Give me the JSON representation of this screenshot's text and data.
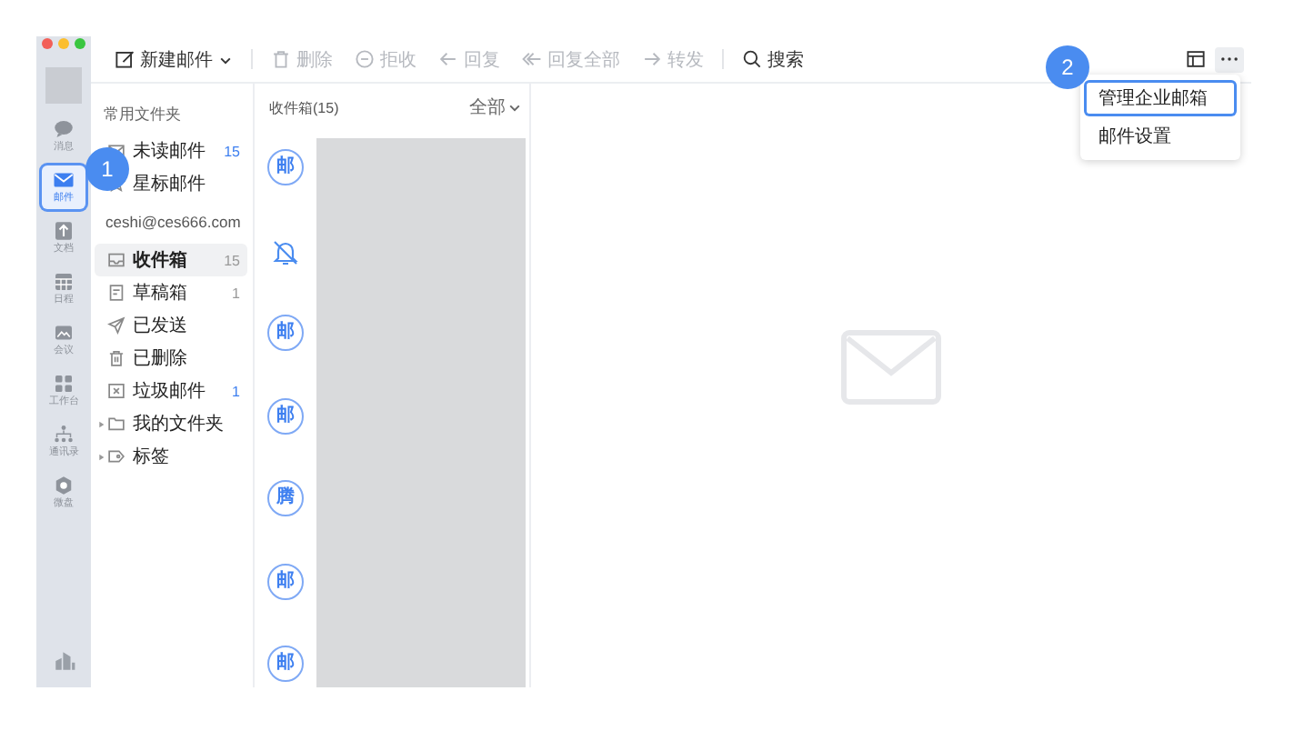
{
  "toolbar": {
    "items": [
      {
        "kind": "compose",
        "label": "新建邮件",
        "disabled": false,
        "dropdown": true
      },
      {
        "kind": "delete",
        "label": "删除",
        "disabled": true
      },
      {
        "kind": "reject",
        "label": "拒收",
        "disabled": true
      },
      {
        "kind": "reply",
        "label": "回复",
        "disabled": true
      },
      {
        "kind": "replyall",
        "label": "回复全部",
        "disabled": true
      },
      {
        "kind": "forward",
        "label": "转发",
        "disabled": true
      }
    ],
    "search": "搜索"
  },
  "sidebar": {
    "items": [
      {
        "kind": "chat",
        "label": "消息",
        "selected": false
      },
      {
        "kind": "mail",
        "label": "邮件",
        "selected": true
      },
      {
        "kind": "doc",
        "label": "文档",
        "selected": false
      },
      {
        "kind": "calendar",
        "label": "日程",
        "selected": false
      },
      {
        "kind": "meeting",
        "label": "会议",
        "selected": false
      },
      {
        "kind": "apps",
        "label": "工作台",
        "selected": false
      },
      {
        "kind": "contacts",
        "label": "通讯录",
        "selected": false
      },
      {
        "kind": "drive",
        "label": "微盘",
        "selected": false
      }
    ]
  },
  "folders": {
    "heading": "常用文件夹",
    "common": [
      {
        "kind": "unread",
        "label": "未读邮件",
        "count": "15",
        "color": "#3d7ff0"
      },
      {
        "kind": "star",
        "label": "星标邮件"
      }
    ],
    "account": "ceshi@ces666.com",
    "items": [
      {
        "kind": "inbox",
        "label": "收件箱",
        "count": "15",
        "color": "#999999",
        "selected": true
      },
      {
        "kind": "draft",
        "label": "草稿箱",
        "count": "1",
        "color": "#999999",
        "selected": false
      },
      {
        "kind": "sent",
        "label": "已发送",
        "selected": false
      },
      {
        "kind": "trash",
        "label": "已删除",
        "selected": false
      },
      {
        "kind": "spam",
        "label": "垃圾邮件",
        "count": "1",
        "color": "#3d7ff0",
        "selected": false
      },
      {
        "kind": "folder",
        "label": "我的文件夹",
        "expanded": false,
        "selected": false
      },
      {
        "kind": "tag",
        "label": "标签",
        "expanded": false,
        "selected": false
      }
    ]
  },
  "message_list": {
    "title": "收件箱(15)",
    "filter": "全部",
    "rows": [
      {
        "kind": "avatar",
        "label": "邮"
      },
      {
        "kind": "bell"
      },
      {
        "kind": "avatar",
        "label": "邮"
      },
      {
        "kind": "avatar",
        "label": "邮"
      },
      {
        "kind": "avatar",
        "label": "腾"
      },
      {
        "kind": "avatar",
        "label": "邮"
      },
      {
        "kind": "avatar",
        "label": "邮"
      }
    ]
  },
  "menu": {
    "items": [
      {
        "label": "管理企业邮箱",
        "selected": true
      },
      {
        "label": "邮件设置",
        "selected": false
      }
    ]
  },
  "callouts": [
    {
      "label": "1"
    },
    {
      "label": "2"
    }
  ]
}
